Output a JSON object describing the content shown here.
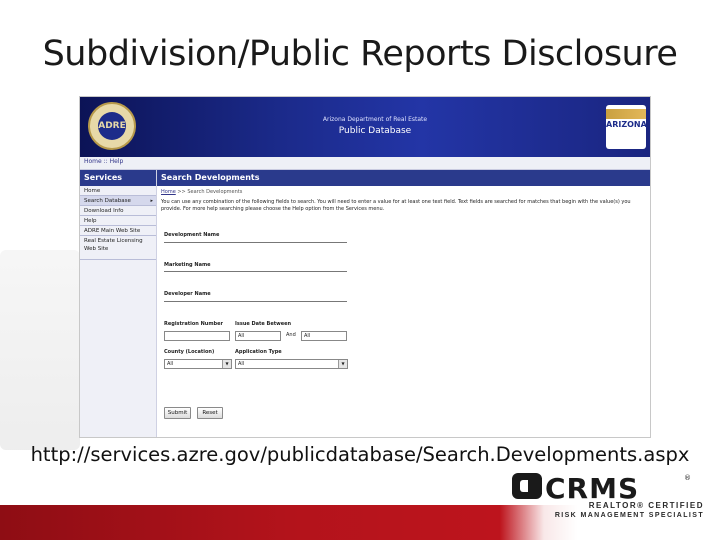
{
  "slide": {
    "title": "Subdivision/Public Reports Disclosure",
    "url": "http://services.azre.gov/publicdatabase/Search.Developments.aspx"
  },
  "banner": {
    "seal_text": "ADRE",
    "line1": "Arizona Department of Real Estate",
    "line2": "Public Database",
    "partner_logo_text": "ARIZONA"
  },
  "breadcrumb_top": "Home :: Help",
  "sidebar": {
    "header": "Services",
    "items": [
      {
        "label": "Home"
      },
      {
        "label": "Search Database"
      },
      {
        "label": "Download Info"
      },
      {
        "label": "Help"
      },
      {
        "label": "ADRE Main Web Site"
      },
      {
        "label": "Real Estate Licensing Web Site"
      }
    ]
  },
  "main": {
    "header": "Search Developments",
    "breadcrumb_home": "Home",
    "breadcrumb_rest": " >> Search Developments",
    "instructions": "You can use any combination of the following fields to search. You will need to enter a value for at least one text field. Text fields are searched for matches that begin with the value(s) you provide. For more help searching please choose the Help option from the Services menu.",
    "fields": {
      "development_name_label": "Development Name",
      "marketing_name_label": "Marketing Name",
      "developer_name_label": "Developer Name",
      "registration_number_label": "Registration Number",
      "issue_date_between_label": "Issue Date Between",
      "and_label": "And",
      "issue_date_from_value": "All",
      "issue_date_to_value": "All",
      "county_label": "County (Location)",
      "county_value": "All",
      "application_type_label": "Application Type",
      "application_type_value": "All"
    },
    "buttons": {
      "submit": "Submit",
      "reset": "Reset"
    }
  },
  "footer_logo": {
    "wordmark": "CRMS",
    "line1": "REALTOR® CERTIFIED",
    "line2": "RISK MANAGEMENT SPECIALIST"
  },
  "colors": {
    "banner_dark": "#0c1356",
    "header_blue": "#2a3a8c",
    "brand_red": "#c8161f"
  }
}
